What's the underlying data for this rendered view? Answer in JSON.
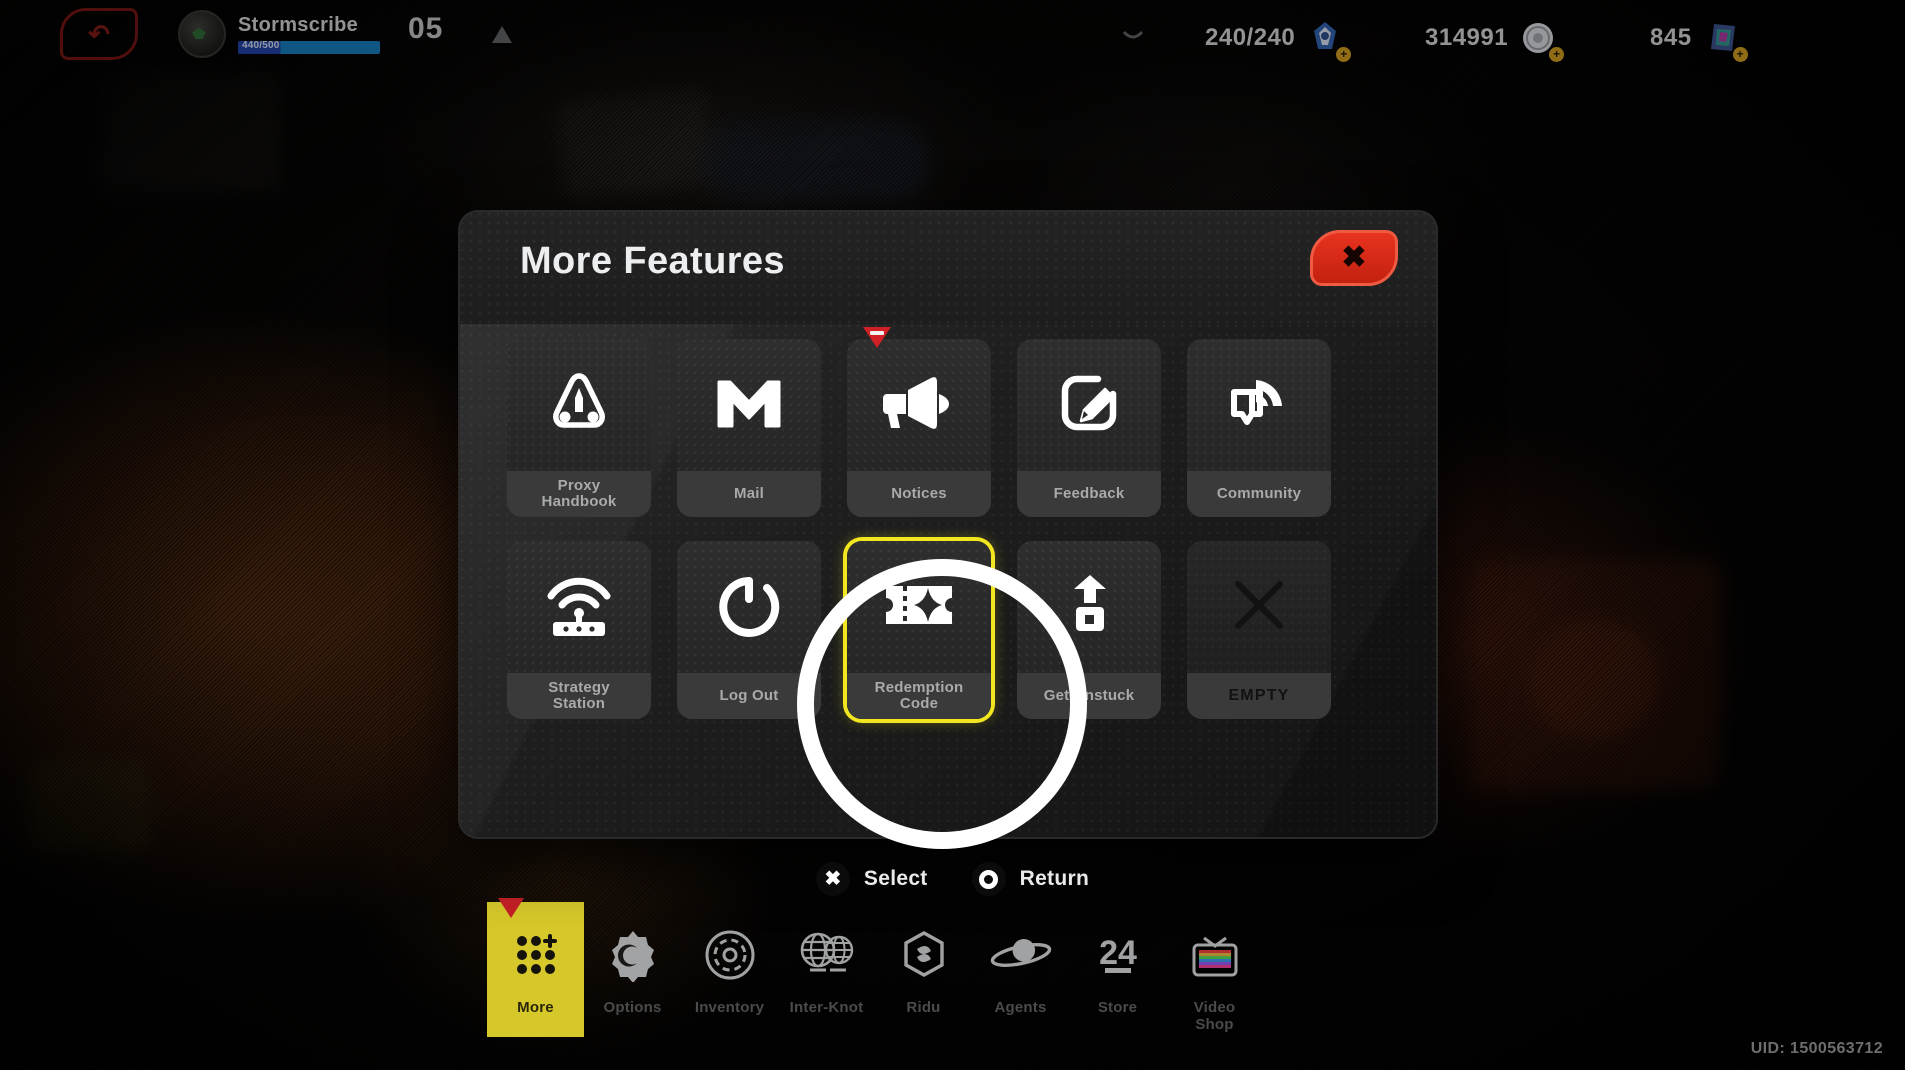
{
  "hud": {
    "back_icon": "back-arrow-icon",
    "player_name": "Stormscribe",
    "xp_text": "440/500",
    "level": "05",
    "rank_icon": "rank-triangle-icon",
    "resources": [
      {
        "name": "stamina",
        "value": "240/240",
        "icon": "stamina-icon"
      },
      {
        "name": "credits",
        "value": "314991",
        "icon": "credit-orb-icon"
      },
      {
        "name": "premium",
        "value": "845",
        "icon": "premium-card-icon"
      }
    ],
    "uid": "UID: 1500563712"
  },
  "modal": {
    "title": "More Features",
    "close_label": "✖",
    "close_icon": "close-x-icon",
    "tiles": [
      {
        "label": "Proxy\nHandbook",
        "icon": "proxy-handbook-icon",
        "state": "normal",
        "badge": false
      },
      {
        "label": "Mail",
        "icon": "mail-icon",
        "state": "normal",
        "badge": false
      },
      {
        "label": "Notices",
        "icon": "megaphone-icon",
        "state": "normal",
        "badge": true
      },
      {
        "label": "Feedback",
        "icon": "feedback-pencil-icon",
        "state": "normal",
        "badge": false
      },
      {
        "label": "Community",
        "icon": "community-signal-icon",
        "state": "normal",
        "badge": false
      },
      {
        "label": "Strategy\nStation",
        "icon": "router-wifi-icon",
        "state": "normal",
        "badge": false
      },
      {
        "label": "Log Out",
        "icon": "power-icon",
        "state": "normal",
        "badge": false
      },
      {
        "label": "Redemption\nCode",
        "icon": "ticket-star-icon",
        "state": "selected",
        "badge": false
      },
      {
        "label": "Get Unstuck",
        "icon": "unstuck-icon",
        "state": "normal",
        "badge": false
      },
      {
        "label": "EMPTY",
        "icon": "empty-x-icon",
        "state": "empty",
        "badge": false
      }
    ]
  },
  "prompts": [
    {
      "button": "cross-button-icon",
      "glyph": "✖",
      "label": "Select"
    },
    {
      "button": "circle-button-icon",
      "glyph": "",
      "label": "Return"
    }
  ],
  "bottom_nav": {
    "items": [
      {
        "label": "More",
        "icon": "grid-dots-icon",
        "active": true,
        "badge": true
      },
      {
        "label": "Options",
        "icon": "gear-moon-icon",
        "active": false,
        "badge": false
      },
      {
        "label": "Inventory",
        "icon": "disc-icon",
        "active": false,
        "badge": false
      },
      {
        "label": "Inter-Knot",
        "icon": "globe-network-icon",
        "active": false,
        "badge": false
      },
      {
        "label": "Ridu",
        "icon": "hex-icon",
        "active": false,
        "badge": false
      },
      {
        "label": "Agents",
        "icon": "planet-icon",
        "active": false,
        "badge": false
      },
      {
        "label": "Store",
        "icon": "store-24-icon",
        "active": false,
        "badge": false
      },
      {
        "label": "Video\nShop",
        "icon": "tv-icon",
        "active": false,
        "badge": false
      }
    ]
  },
  "annotation": {
    "focus_target": "Redemption Code",
    "shape": "highlight-circle"
  },
  "colors": {
    "accent_yellow": "#f2e620",
    "nav_active": "#d6c82a",
    "danger_red": "#d01f25",
    "close_red": "#e8331f",
    "modal_bg": "#1f1f1f",
    "tile_bg": "#2a2a2a",
    "label_bg": "#3a3a3a"
  }
}
